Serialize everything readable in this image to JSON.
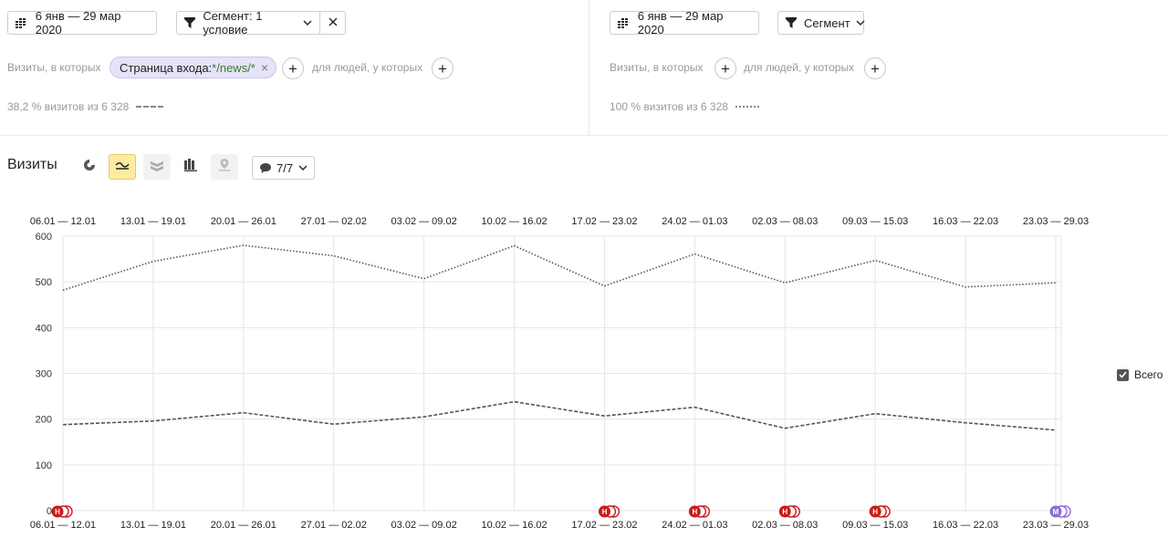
{
  "left_panel": {
    "date_range": "6 янв — 29 мар 2020",
    "segment_label": "Сегмент: 1 условие",
    "visits_label": "Визиты, в которых",
    "chip_key": "Страница входа: ",
    "chip_value": "*/news/*",
    "people_label": "для людей, у которых",
    "stat_text": "38,2 % визитов из 6 328"
  },
  "right_panel": {
    "date_range": "6 янв — 29 мар 2020",
    "segment_label": "Сегмент",
    "visits_label": "Визиты, в которых",
    "people_label": "для людей, у которых",
    "stat_text": "100 % визитов из 6 328"
  },
  "chart_header": {
    "title": "Визиты",
    "notes_label": "7/7"
  },
  "legend": {
    "label": "Всего"
  },
  "chart_data": {
    "type": "line",
    "categories": [
      "06.01 — 12.01",
      "13.01 — 19.01",
      "20.01 — 26.01",
      "27.01 — 02.02",
      "03.02 — 09.02",
      "10.02 — 16.02",
      "17.02 — 23.02",
      "24.02 — 01.03",
      "02.03 — 08.03",
      "09.03 — 15.03",
      "16.03 — 22.03",
      "23.03 — 29.03"
    ],
    "y_ticks": [
      0,
      100,
      200,
      300,
      400,
      500,
      600
    ],
    "ylim": [
      0,
      600
    ],
    "grid": true,
    "series": [
      {
        "style": "dotted",
        "color": "#555555",
        "values": [
          482,
          545,
          580,
          557,
          507,
          579,
          491,
          561,
          498,
          547,
          489,
          498
        ]
      },
      {
        "style": "dashed",
        "color": "#555555",
        "values": [
          188,
          196,
          214,
          189,
          205,
          238,
          207,
          226,
          180,
          212,
          192,
          176
        ]
      }
    ],
    "annotations": [
      {
        "x_index": 0,
        "text": "Н",
        "color": "#cc1b1b"
      },
      {
        "x_index": 6,
        "text": "Н",
        "color": "#cc1b1b"
      },
      {
        "x_index": 7,
        "text": "Н",
        "color": "#cc1b1b"
      },
      {
        "x_index": 8,
        "text": "Н",
        "color": "#cc1b1b"
      },
      {
        "x_index": 9,
        "text": "Н",
        "color": "#cc1b1b"
      },
      {
        "x_index": 11,
        "text": "М",
        "color": "#8c6fd6"
      }
    ]
  }
}
